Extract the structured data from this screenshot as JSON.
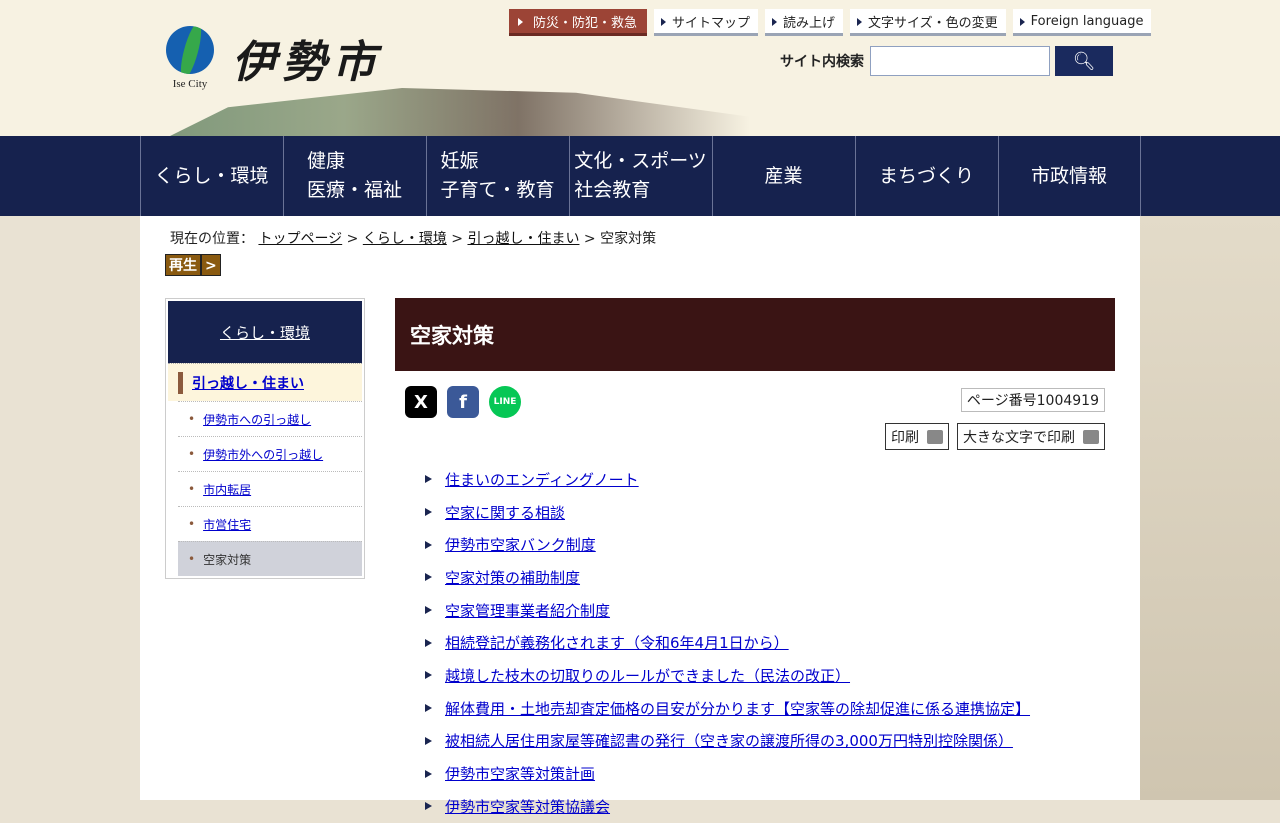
{
  "header": {
    "logo_text": "伊勢市",
    "logo_sub": "Ise City",
    "top_links": [
      "防災・防犯・救急",
      "サイトマップ",
      "読み上げ",
      "文字サイズ・色の変更",
      "Foreign language"
    ],
    "search": {
      "label": "サイト内検索",
      "value": "",
      "button": "search-icon"
    }
  },
  "global_nav": [
    [
      "くらし・環境"
    ],
    [
      "健康",
      "医療・福祉"
    ],
    [
      "妊娠",
      "子育て・教育"
    ],
    [
      "文化・スポーツ",
      "社会教育"
    ],
    [
      "産業"
    ],
    [
      "まちづくり"
    ],
    [
      "市政情報"
    ]
  ],
  "breadcrumb": {
    "prefix": "現在の位置：",
    "items": [
      "トップページ",
      "くらし・環境",
      "引っ越し・住まい"
    ],
    "current": "空家対策",
    "sep": ">"
  },
  "play_button": "再生",
  "sidebar": {
    "heading": "くらし・環境",
    "current_section": "引っ越し・住まい",
    "items": [
      "伊勢市への引っ越し",
      "伊勢市外への引っ越し",
      "市内転居",
      "市営住宅",
      "空家対策"
    ]
  },
  "content": {
    "title": "空家対策",
    "page_number": "ページ番号1004919",
    "print": "印刷",
    "print_large": "大きな文字で印刷",
    "share": [
      "X",
      "f",
      "LINE"
    ],
    "links": [
      "住まいのエンディングノート",
      "空家に関する相談",
      "伊勢市空家バンク制度",
      "空家対策の補助制度",
      "空家管理事業者紹介制度",
      "相続登記が義務化されます（令和6年4月1日から）",
      "越境した枝木の切取りのルールができました（民法の改正）",
      "解体費用・土地売却査定価格の目安が分かります【空家等の除却促進に係る連携協定】",
      "被相続人居住用家屋等確認書の発行（空き家の譲渡所得の3,000万円特別控除関係）",
      "伊勢市空家等対策計画",
      "伊勢市空家等対策協議会"
    ]
  }
}
